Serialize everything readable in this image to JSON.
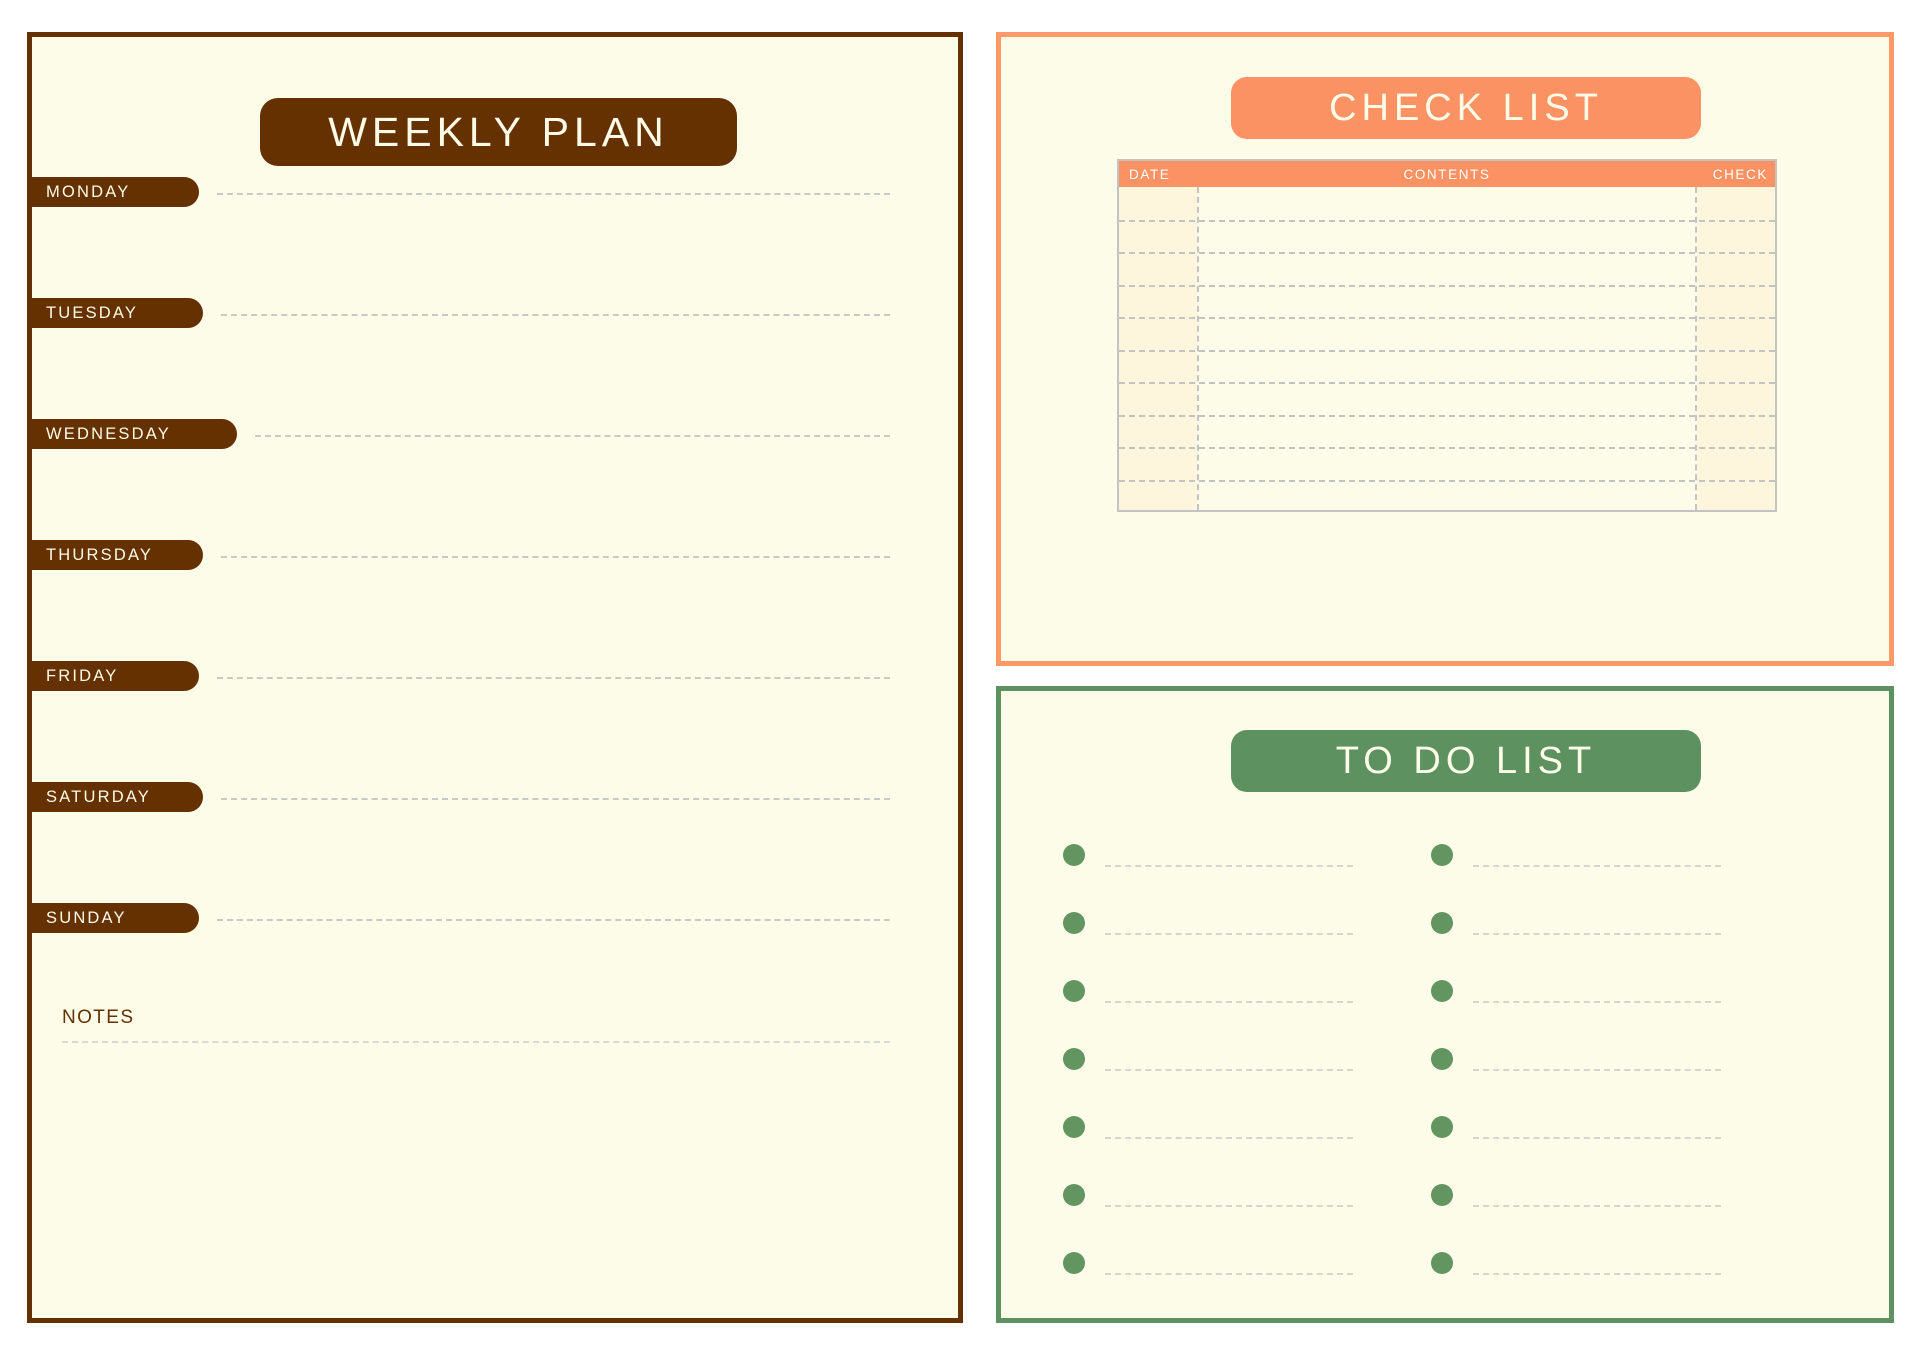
{
  "page": {
    "background": "#ffffff"
  },
  "theme": {
    "brown": "#653100",
    "orange": "#fb9263",
    "orange_border": "#fb9a68",
    "green": "#5e9160",
    "green_bullet": "#629560",
    "cream": "#fdfce9",
    "column_tint": "#fdf6dc",
    "dash_gray": "#c3c3c3",
    "dash_light": "#d4d4d0"
  },
  "weekly_plan": {
    "title": "WEEKLY PLAN",
    "days": [
      {
        "label": "MONDAY",
        "width_class": "w-short"
      },
      {
        "label": "TUESDAY",
        "width_class": "w-med"
      },
      {
        "label": "WEDNESDAY",
        "width_class": "w-long"
      },
      {
        "label": "THURSDAY",
        "width_class": "w-med"
      },
      {
        "label": "FRIDAY",
        "width_class": "w-short"
      },
      {
        "label": "SATURDAY",
        "width_class": "w-med"
      },
      {
        "label": "SUNDAY",
        "width_class": "w-short"
      }
    ],
    "notes_label": "NOTES"
  },
  "check_list": {
    "title": "CHECK LIST",
    "columns": [
      "DATE",
      "CONTENTS",
      "CHECK"
    ],
    "row_count": 10,
    "rows": [
      {
        "date": "",
        "contents": "",
        "check": ""
      },
      {
        "date": "",
        "contents": "",
        "check": ""
      },
      {
        "date": "",
        "contents": "",
        "check": ""
      },
      {
        "date": "",
        "contents": "",
        "check": ""
      },
      {
        "date": "",
        "contents": "",
        "check": ""
      },
      {
        "date": "",
        "contents": "",
        "check": ""
      },
      {
        "date": "",
        "contents": "",
        "check": ""
      },
      {
        "date": "",
        "contents": "",
        "check": ""
      },
      {
        "date": "",
        "contents": "",
        "check": ""
      },
      {
        "date": "",
        "contents": "",
        "check": ""
      }
    ]
  },
  "to_do_list": {
    "title": "TO DO LIST",
    "left_items": [
      {
        "text": ""
      },
      {
        "text": ""
      },
      {
        "text": ""
      },
      {
        "text": ""
      },
      {
        "text": ""
      },
      {
        "text": ""
      },
      {
        "text": ""
      }
    ],
    "right_items": [
      {
        "text": ""
      },
      {
        "text": ""
      },
      {
        "text": ""
      },
      {
        "text": ""
      },
      {
        "text": ""
      },
      {
        "text": ""
      },
      {
        "text": ""
      }
    ]
  }
}
